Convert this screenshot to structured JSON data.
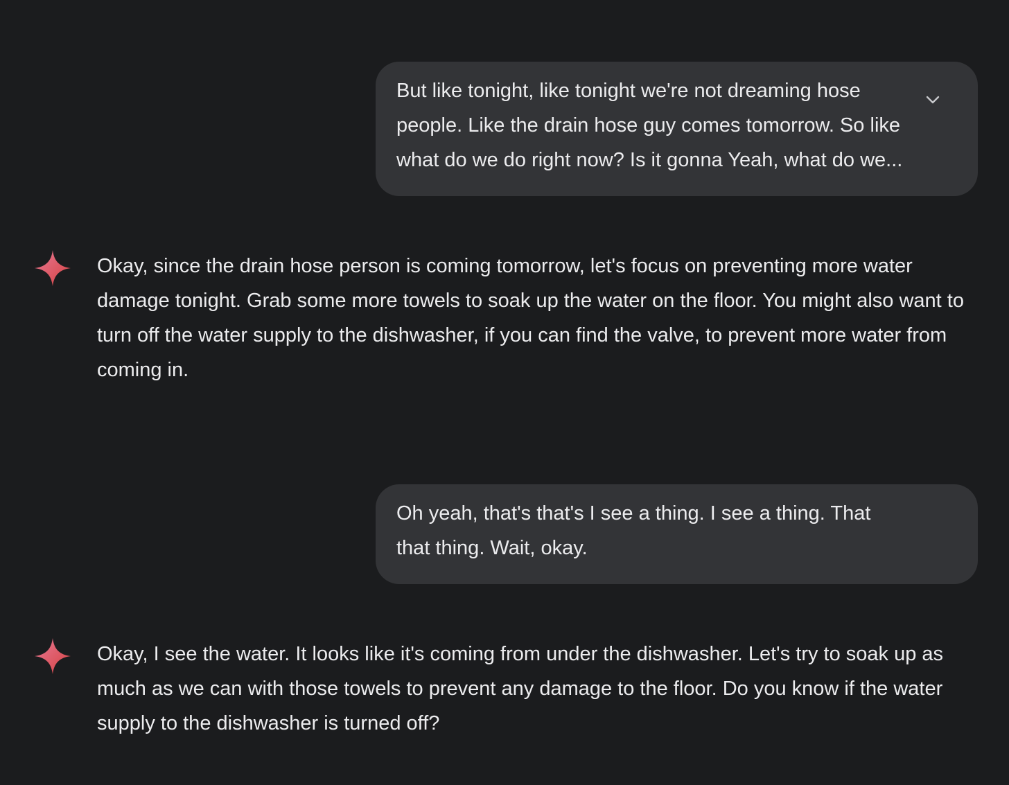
{
  "messages": [
    {
      "role": "user",
      "text": "But like tonight, like tonight we're not dreaming hose people. Like the drain hose guy comes tomorrow. So like what do we do right now? Is it gonna Yeah, what do we...",
      "expand_icon": "chevron-down-icon"
    },
    {
      "role": "assistant",
      "icon": "sparkle-icon",
      "text": "Okay, since the drain hose person is coming tomorrow, let's focus on preventing more water damage tonight. Grab some more towels to soak up the water on the floor. You might also want to turn off the water supply to the dishwasher, if you can find the valve, to prevent more water from coming in."
    },
    {
      "role": "user",
      "text": "Oh yeah, that's that's I see a thing. I see a thing. That that thing. Wait, okay."
    },
    {
      "role": "assistant",
      "icon": "sparkle-icon",
      "text": "Okay, I see the water. It looks like it's coming from under the dishwasher. Let's try to soak up as much as we can with those towels to prevent any damage to the floor. Do you know if the water supply to the dishwasher is turned off?"
    }
  ],
  "colors": {
    "background": "#1b1c1e",
    "user_bubble": "#333437",
    "text": "#ececee",
    "sparkle_start": "#e06a8a",
    "sparkle_end": "#d94848"
  }
}
